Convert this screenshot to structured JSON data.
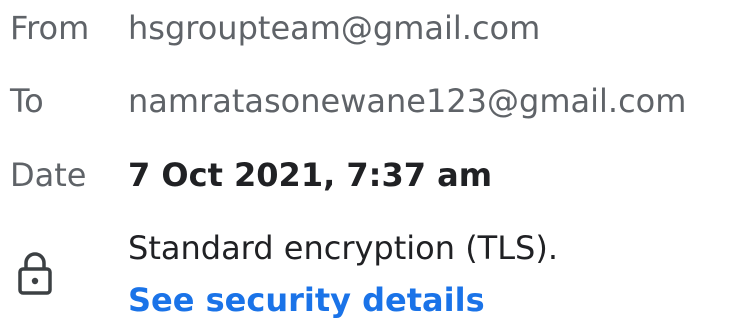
{
  "email_details": {
    "from": {
      "label": "From",
      "value": "hsgroupteam@gmail.com"
    },
    "to": {
      "label": "To",
      "value": "namratasonewane123@gmail.com"
    },
    "date": {
      "label": "Date",
      "value": "7 Oct 2021, 7:37 am"
    },
    "security": {
      "icon": "lock-icon",
      "text": "Standard encryption (TLS).",
      "link_label": "See security details",
      "link_color": "#1a73e8"
    }
  }
}
